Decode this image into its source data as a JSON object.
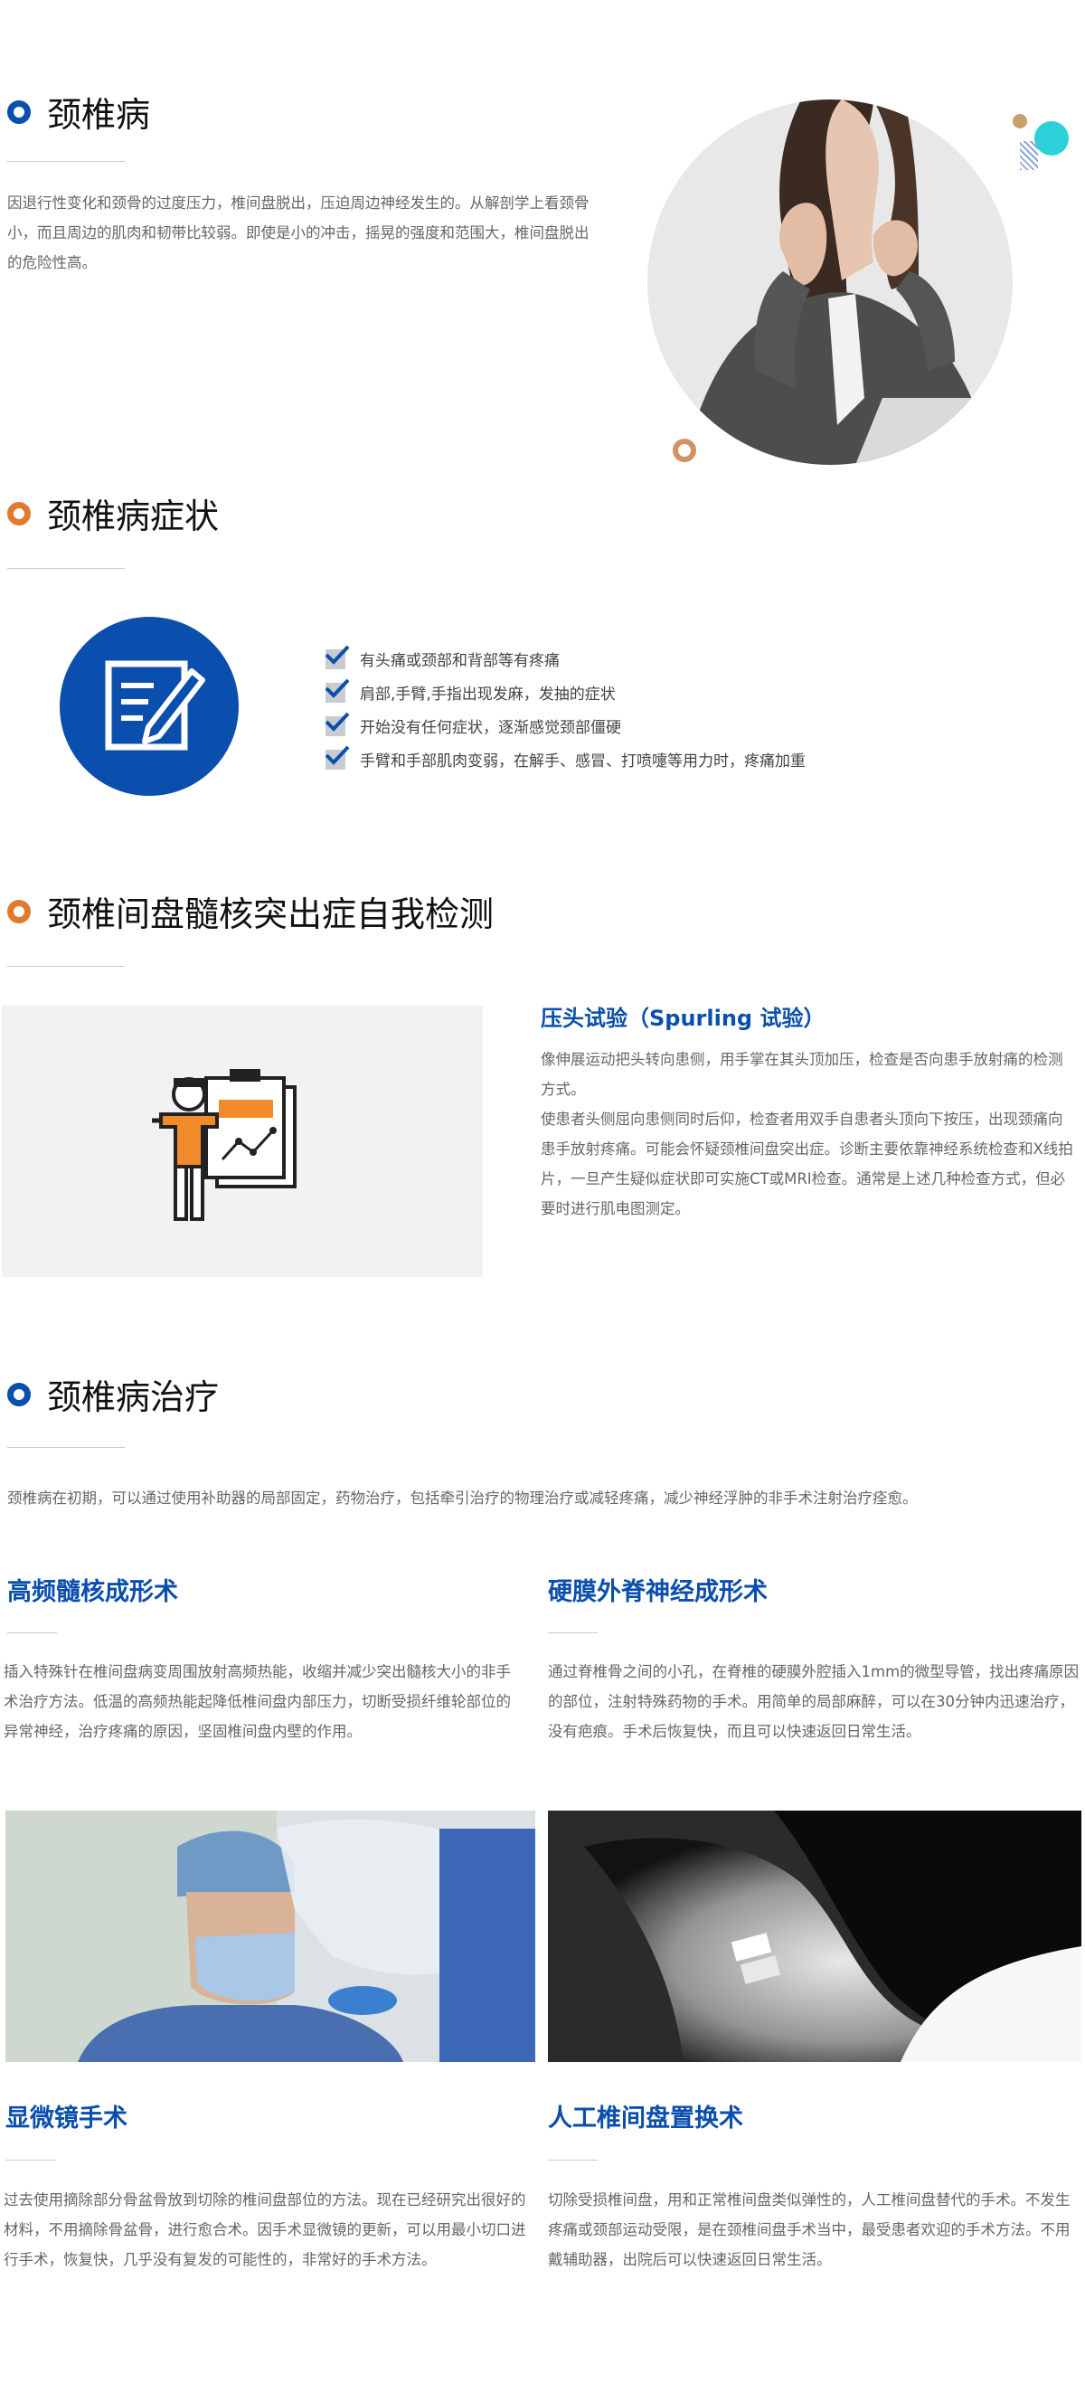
{
  "colors": {
    "brand_blue": "#0b4fae",
    "accent_orange": "#e07a2e",
    "text_gray": "#666666"
  },
  "section1": {
    "title": "颈椎病",
    "body": "因退行性变化和颈骨的过度压力，椎间盘脱出，压迫周边神经发生的。从解剖学上看颈骨小，而且周边的肌肉和韧带比较弱。即使是小的冲击，摇晃的强度和范围大，椎间盘脱出的危险性高。"
  },
  "section2": {
    "title": "颈椎病症状",
    "symptoms": [
      "有头痛或颈部和背部等有疼痛",
      "肩部,手臂,手指出现发麻，发抽的症状",
      "开始没有任何症状，逐渐感觉颈部僵硬",
      "手臂和手部肌肉变弱，在解手、感冒、打喷嚏等用力时，疼痛加重"
    ]
  },
  "section3": {
    "title": "颈椎间盘髓核突出症自我检测",
    "test_title": "压头试验（Spurling 试验）",
    "test_body1": "像伸展运动把头转向患侧，用手掌在其头顶加压，检查是否向患手放射痛的检测方式。",
    "test_body2": "使患者头侧屈向患侧同时后仰，检查者用双手自患者头顶向下按压，出现颈痛向患手放射疼痛。可能会怀疑颈椎间盘突出症。诊断主要依靠神经系统检查和X线拍片，一旦产生疑似症状即可实施CT或MRI检查。通常是上述几种检查方式，但必要时进行肌电图测定。"
  },
  "section4": {
    "title": "颈椎病治疗",
    "intro": "颈椎病在初期，可以通过使用补助器的局部固定，药物治疗，包括牵引治疗的物理治疗或减轻疼痛，减少神经浮肿的非手术注射治疗痊愈。",
    "t1": {
      "title": "高频髓核成形术",
      "body": "插入特殊针在椎间盘病变周围放射高频热能，收缩并减少突出髓核大小的非手术治疗方法。低温的高频热能起降低椎间盘内部压力，切断受损纤维轮部位的异常神经，治疗疼痛的原因，坚固椎间盘内壁的作用。"
    },
    "t2": {
      "title": "硬膜外脊神经成形术",
      "body": "通过脊椎骨之间的小孔，在脊椎的硬膜外腔插入1mm的微型导管，找出疼痛原因的部位，注射特殊药物的手术。用简单的局部麻醉，可以在30分钟内迅速治疗，没有疤痕。手术后恢复快，而且可以快速返回日常生活。"
    },
    "t3": {
      "title": "显微镜手术",
      "body": "过去使用摘除部分骨盆骨放到切除的椎间盘部位的方法。现在已经研究出很好的材料，不用摘除骨盆骨，进行愈合术。因手术显微镜的更新，可以用最小切口进行手术，恢复快，几乎没有复发的可能性的，非常好的手术方法。"
    },
    "t4": {
      "title": "人工椎间盘置换术",
      "body": "切除受损椎间盘，用和正常椎间盘类似弹性的，人工椎间盘替代的手术。不发生疼痛或颈部运动受限，是在颈椎间盘手术当中，最受患者欢迎的手术方法。不用戴辅助器，出院后可以快速返回日常生活。"
    }
  }
}
